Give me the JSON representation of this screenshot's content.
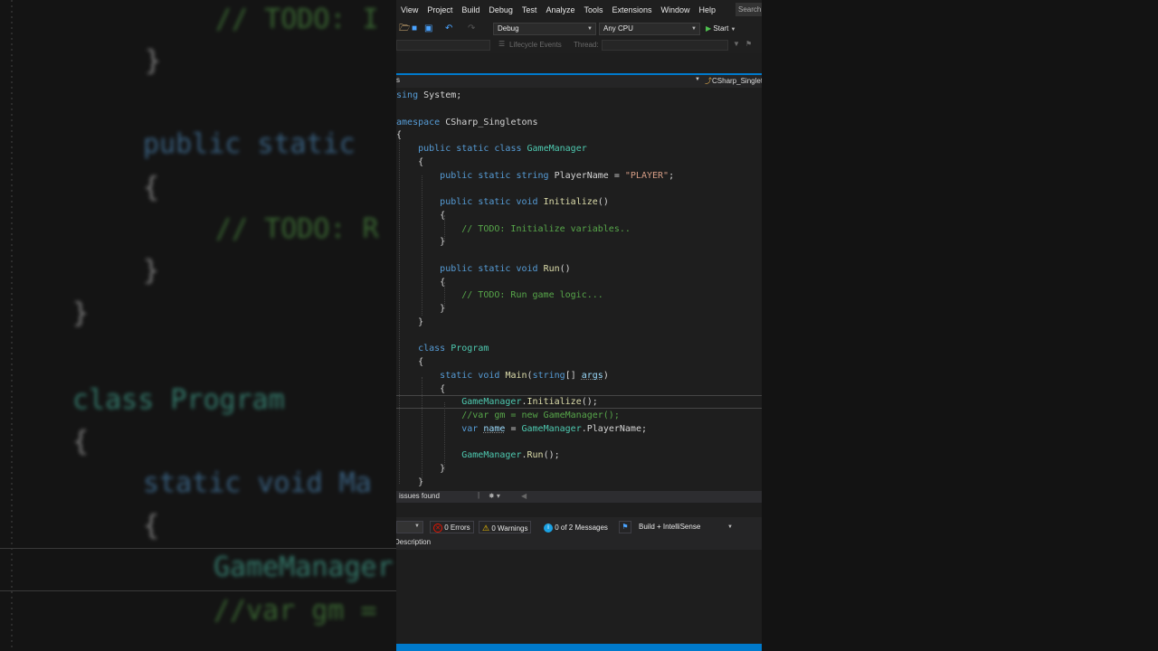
{
  "background_left_lines": [
    {
      "text": "// TODO: I",
      "color": "#57a64a"
    },
    {
      "text": "}",
      "color": "#d4d4d4"
    },
    {
      "text": "public static",
      "color": "#569cd6"
    },
    {
      "text": "{",
      "color": "#d4d4d4"
    },
    {
      "text": "// TODO: R",
      "color": "#57a64a"
    },
    {
      "text": "}",
      "color": "#d4d4d4"
    },
    {
      "text": "}",
      "color": "#d4d4d4"
    },
    {
      "text": "class Program",
      "color": "#4ec9b0"
    },
    {
      "text": "{",
      "color": "#d4d4d4"
    },
    {
      "text": "static void Ma",
      "color": "#569cd6"
    },
    {
      "text": "{",
      "color": "#d4d4d4"
    },
    {
      "text": "GameManager",
      "color": "#4ec9b0"
    },
    {
      "text": "//var gm =",
      "color": "#57a64a"
    }
  ],
  "menu": [
    "View",
    "Project",
    "Build",
    "Debug",
    "Test",
    "Analyze",
    "Tools",
    "Extensions",
    "Window",
    "Help"
  ],
  "search_label": "Search",
  "toolbar": {
    "config": "Debug",
    "platform": "Any CPU",
    "start": "Start",
    "lifecycle": "Lifecycle Events",
    "thread": "Thread:"
  },
  "navbar": {
    "left": "s",
    "right": "CSharp_Singletons"
  },
  "code": [
    {
      "tokens": [
        [
          "kw",
          "using"
        ],
        [
          "pl",
          " System;"
        ]
      ]
    },
    {
      "tokens": []
    },
    {
      "tokens": [
        [
          "kw",
          "namespace"
        ],
        [
          "pl",
          " CSharp_Singletons"
        ]
      ]
    },
    {
      "tokens": [
        [
          "pl",
          "{"
        ]
      ]
    },
    {
      "tokens": [
        [
          "pl",
          "    "
        ],
        [
          "kw",
          "public static class"
        ],
        [
          "pl",
          " "
        ],
        [
          "ty",
          "GameManager"
        ]
      ]
    },
    {
      "tokens": [
        [
          "pl",
          "    {"
        ]
      ]
    },
    {
      "tokens": [
        [
          "pl",
          "        "
        ],
        [
          "kw",
          "public static string"
        ],
        [
          "pl",
          " PlayerName = "
        ],
        [
          "st",
          "\"PLAYER\""
        ],
        [
          "pl",
          ";"
        ]
      ]
    },
    {
      "tokens": []
    },
    {
      "tokens": [
        [
          "pl",
          "        "
        ],
        [
          "kw",
          "public static void"
        ],
        [
          "pl",
          " "
        ],
        [
          "fn",
          "Initialize"
        ],
        [
          "pl",
          "()"
        ]
      ]
    },
    {
      "tokens": [
        [
          "pl",
          "        {"
        ]
      ]
    },
    {
      "tokens": [
        [
          "pl",
          "            "
        ],
        [
          "cm",
          "// TODO: Initialize variables.."
        ]
      ]
    },
    {
      "tokens": [
        [
          "pl",
          "        }"
        ]
      ]
    },
    {
      "tokens": []
    },
    {
      "tokens": [
        [
          "pl",
          "        "
        ],
        [
          "kw",
          "public static void"
        ],
        [
          "pl",
          " "
        ],
        [
          "fn",
          "Run"
        ],
        [
          "pl",
          "()"
        ]
      ]
    },
    {
      "tokens": [
        [
          "pl",
          "        {"
        ]
      ]
    },
    {
      "tokens": [
        [
          "pl",
          "            "
        ],
        [
          "cm",
          "// TODO: Run game logic..."
        ]
      ]
    },
    {
      "tokens": [
        [
          "pl",
          "        }"
        ]
      ]
    },
    {
      "tokens": [
        [
          "pl",
          "    }"
        ]
      ]
    },
    {
      "tokens": []
    },
    {
      "tokens": [
        [
          "pl",
          "    "
        ],
        [
          "kw",
          "class"
        ],
        [
          "pl",
          " "
        ],
        [
          "ty",
          "Program"
        ]
      ]
    },
    {
      "tokens": [
        [
          "pl",
          "    {"
        ]
      ]
    },
    {
      "tokens": [
        [
          "pl",
          "        "
        ],
        [
          "kw",
          "static void"
        ],
        [
          "pl",
          " "
        ],
        [
          "fn",
          "Main"
        ],
        [
          "pl",
          "("
        ],
        [
          "kw",
          "string"
        ],
        [
          "pl",
          "[] "
        ],
        [
          "vr",
          "args"
        ],
        [
          "pl",
          ")"
        ]
      ]
    },
    {
      "tokens": [
        [
          "pl",
          "        {"
        ]
      ]
    },
    {
      "tokens": [
        [
          "pl",
          "            "
        ],
        [
          "ty",
          "GameManager"
        ],
        [
          "pl",
          "."
        ],
        [
          "fn",
          "Initialize"
        ],
        [
          "pl",
          "();"
        ]
      ]
    },
    {
      "tokens": [
        [
          "pl",
          "            "
        ],
        [
          "cm",
          "//var gm = new GameManager();"
        ]
      ]
    },
    {
      "tokens": [
        [
          "pl",
          "            "
        ],
        [
          "kw",
          "var"
        ],
        [
          "pl",
          " "
        ],
        [
          "vr",
          "name"
        ],
        [
          "pl",
          " = "
        ],
        [
          "ty",
          "GameManager"
        ],
        [
          "pl",
          ".PlayerName;"
        ]
      ]
    },
    {
      "tokens": []
    },
    {
      "tokens": [
        [
          "pl",
          "            "
        ],
        [
          "ty",
          "GameManager"
        ],
        [
          "pl",
          "."
        ],
        [
          "fn",
          "Run"
        ],
        [
          "pl",
          "();"
        ]
      ]
    },
    {
      "tokens": [
        [
          "pl",
          "        }"
        ]
      ]
    },
    {
      "tokens": [
        [
          "pl",
          "    }"
        ]
      ]
    }
  ],
  "status": {
    "issues": "issues found"
  },
  "errorlist": {
    "errors": "0 Errors",
    "warnings": "0 Warnings",
    "messages": "0 of 2 Messages",
    "filter": "Build + IntelliSense",
    "description": "Description"
  }
}
